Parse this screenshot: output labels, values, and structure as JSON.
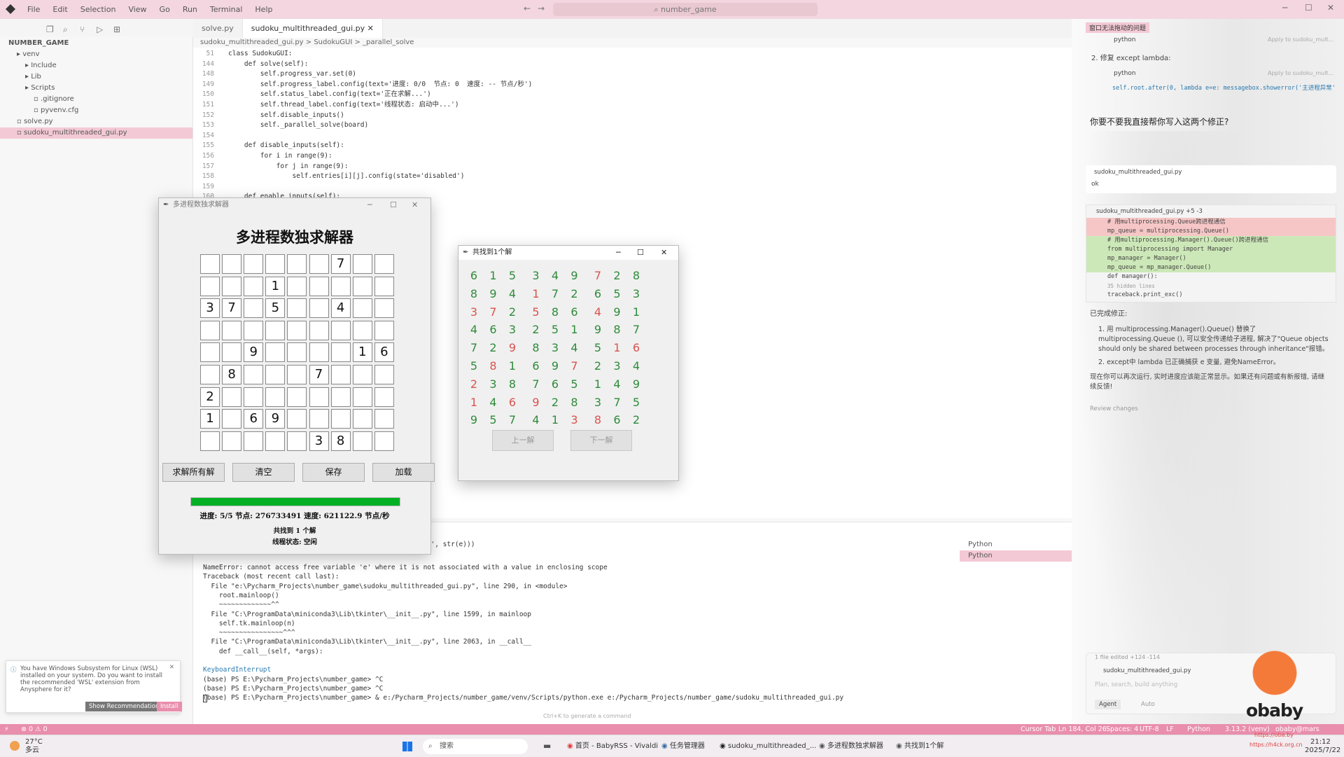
{
  "menu": [
    "File",
    "Edit",
    "Selection",
    "View",
    "Go",
    "Run",
    "Terminal",
    "Help"
  ],
  "search": "number_game",
  "explorer": {
    "root": "NUMBER_GAME",
    "items": [
      {
        "label": "venv",
        "indent": 1
      },
      {
        "label": "Include",
        "indent": 2
      },
      {
        "label": "Lib",
        "indent": 2
      },
      {
        "label": "Scripts",
        "indent": 2
      },
      {
        "label": ".gitignore",
        "indent": 3
      },
      {
        "label": "pyvenv.cfg",
        "indent": 3
      },
      {
        "label": "solve.py",
        "indent": 1
      },
      {
        "label": "sudoku_multithreaded_gui.py",
        "indent": 1,
        "selected": true
      }
    ]
  },
  "tabs": [
    {
      "label": "solve.py",
      "active": false
    },
    {
      "label": "sudoku_multithreaded_gui.py",
      "active": true
    }
  ],
  "breadcrumb": "sudoku_multithreaded_gui.py  >  SudokuGUI  >  _parallel_solve",
  "code": [
    {
      "n": "51",
      "t": "class SudokuGUI:"
    },
    {
      "n": "144",
      "t": "    def solve(self):"
    },
    {
      "n": "148",
      "t": "        self.progress_var.set(0)"
    },
    {
      "n": "149",
      "t": "        self.progress_label.config(text='进度: 0/0  节点: 0  速度: -- 节点/秒')"
    },
    {
      "n": "150",
      "t": "        self.status_label.config(text='正在求解...')"
    },
    {
      "n": "151",
      "t": "        self.thread_label.config(text='线程状态: 启动中...')"
    },
    {
      "n": "152",
      "t": "        self.disable_inputs()"
    },
    {
      "n": "153",
      "t": "        self._parallel_solve(board)"
    },
    {
      "n": "154",
      "t": ""
    },
    {
      "n": "155",
      "t": "    def disable_inputs(self):"
    },
    {
      "n": "156",
      "t": "        for i in range(9):"
    },
    {
      "n": "157",
      "t": "            for j in range(9):"
    },
    {
      "n": "158",
      "t": "                self.entries[i][j].config(state='disabled')"
    },
    {
      "n": "159",
      "t": ""
    },
    {
      "n": "160",
      "t": "    def enable_inputs(self):"
    }
  ],
  "terminal": [
    "NameError: cannot access free variable 'e' where it is not associated with a value in enclosing scope",
    "Traceback (most recent call last):",
    "  File \"e:\\Pycharm_Projects\\number_game\\sudoku_multithreaded_gui.py\", line 290, in <module>",
    "    root.mainloop()",
    "    ~~~~~~~~~~~~~^^",
    "  File \"C:\\ProgramData\\miniconda3\\Lib\\tkinter\\__init__.py\", line 1599, in mainloop",
    "    self.tk.mainloop(n)",
    "    ~~~~~~~~~~~~~~~~^^^",
    "  File \"C:\\ProgramData\\miniconda3\\Lib\\tkinter\\__init__.py\", line 2063, in __call__",
    "    def __call__(self, *args):",
    "",
    "KeyboardInterrupt",
    "(base) PS E:\\Pycharm_Projects\\number_game> ^C",
    "(base) PS E:\\Pycharm_Projects\\number_game> ^C",
    "(base) PS E:\\Pycharm_Projects\\number_game> & e:/Pycharm_Projects/number_game/venv/Scripts/python.exe e:/Pycharm_Projects/number_game/sudoku_multithreaded_gui.py"
  ],
  "terminal_top": "常', str(e)))",
  "terminal_hint": "Ctrl+K to generate a command",
  "panel_terms": [
    "Python",
    "Python"
  ],
  "solver": {
    "window_title": "多进程数独求解器",
    "title": "多进程数独求解器",
    "grid": [
      [
        "",
        "",
        "",
        "",
        "",
        "",
        "7",
        "",
        ""
      ],
      [
        "",
        "",
        "",
        "1",
        "",
        "",
        "",
        "",
        ""
      ],
      [
        "3",
        "7",
        "",
        "5",
        "",
        "",
        "4",
        "",
        ""
      ],
      [
        "",
        "",
        "",
        "",
        "",
        "",
        "",
        "",
        ""
      ],
      [
        "",
        "",
        "9",
        "",
        "",
        "",
        "",
        "1",
        "6"
      ],
      [
        "",
        "8",
        "",
        "",
        "",
        "7",
        "",
        "",
        ""
      ],
      [
        "2",
        "",
        "",
        "",
        "",
        "",
        "",
        "",
        ""
      ],
      [
        "1",
        "",
        "6",
        "9",
        "",
        "",
        "",
        "",
        ""
      ],
      [
        "",
        "",
        "",
        "",
        "",
        "3",
        "8",
        "",
        ""
      ]
    ],
    "buttons": [
      "求解所有解",
      "清空",
      "保存",
      "加载"
    ],
    "progress": 1.0,
    "progress_text": "进度: 5/5  节点: 276733491  速度: 621122.9 节点/秒",
    "status_text": "共找到 1 个解",
    "thread_text": "线程状态: 空闲"
  },
  "solutions": {
    "window_title": "共找到1个解",
    "grid": [
      [
        "6",
        "1",
        "5",
        "3",
        "4",
        "9",
        "7",
        "2",
        "8"
      ],
      [
        "8",
        "9",
        "4",
        "1",
        "7",
        "2",
        "6",
        "5",
        "3"
      ],
      [
        "3",
        "7",
        "2",
        "5",
        "8",
        "6",
        "4",
        "9",
        "1"
      ],
      [
        "4",
        "6",
        "3",
        "2",
        "5",
        "1",
        "9",
        "8",
        "7"
      ],
      [
        "7",
        "2",
        "9",
        "8",
        "3",
        "4",
        "5",
        "1",
        "6"
      ],
      [
        "5",
        "8",
        "1",
        "6",
        "9",
        "7",
        "2",
        "3",
        "4"
      ],
      [
        "2",
        "3",
        "8",
        "7",
        "6",
        "5",
        "1",
        "4",
        "9"
      ],
      [
        "1",
        "4",
        "6",
        "9",
        "2",
        "8",
        "3",
        "7",
        "5"
      ],
      [
        "9",
        "5",
        "7",
        "4",
        "1",
        "3",
        "8",
        "6",
        "2"
      ]
    ],
    "red": [
      [
        0,
        6
      ],
      [
        1,
        3
      ],
      [
        2,
        0
      ],
      [
        2,
        1
      ],
      [
        2,
        3
      ],
      [
        2,
        6
      ],
      [
        4,
        2
      ],
      [
        4,
        7
      ],
      [
        4,
        8
      ],
      [
        5,
        1
      ],
      [
        5,
        5
      ],
      [
        6,
        0
      ],
      [
        7,
        0
      ],
      [
        7,
        2
      ],
      [
        7,
        3
      ],
      [
        8,
        5
      ],
      [
        8,
        6
      ]
    ],
    "prev_label": "上一解",
    "next_label": "下一解"
  },
  "chat": {
    "header": "窗口无法拖动的问题",
    "lang1": "python",
    "apply": "Apply to sudoku_mult...",
    "fix2": "2. 修复 except lambda:",
    "lang2": "python",
    "code_line": "self.root.after(0, lambda e=e: messagebox.showerror('主进程异常'",
    "question": "你要不要我直接帮你写入这两个修正?",
    "file_chip": "sudoku_multithreaded_gui.py",
    "user_msg": "ok",
    "diff_file": "sudoku_multithreaded_gui.py +5 -3",
    "diff": [
      {
        "t": "# 用multiprocessing.Queue跨进程通信",
        "c": "del"
      },
      {
        "t": "mp_queue = multiprocessing.Queue()",
        "c": "del"
      },
      {
        "t": "# 用multiprocessing.Manager().Queue()跨进程通信",
        "c": "add"
      },
      {
        "t": "from multiprocessing import Manager",
        "c": "add"
      },
      {
        "t": "mp_manager = Manager()",
        "c": "add"
      },
      {
        "t": "mp_queue = mp_manager.Queue()",
        "c": "add"
      },
      {
        "t": "def manager():",
        "c": ""
      },
      {
        "t": "35 hidden lines",
        "c": "hint"
      },
      {
        "t": "    traceback.print_exc()",
        "c": ""
      }
    ],
    "done": "已完成修正:",
    "item1": "1. 用 multiprocessing.Manager().Queue() 替换了 multiprocessing.Queue (), 可以安全传递给子进程, 解决了\"Queue objects should only be shared between processes through inheritance\"报错。",
    "item2": "2. except中 lambda 已正确捕获 e 变量, 避免NameError。",
    "final": "现在你可以再次运行, 实时进度应该能正常显示。如果还有问题或有新报错, 请继续反馈!",
    "review": "Review changes",
    "files_edited": "1 file edited +124 -114",
    "input_file": "sudoku_multithreaded_gui.py",
    "input_placeholder": "Plan, search, build anything",
    "agent": "Agent",
    "auto": "Auto"
  },
  "notif": {
    "text": "You have Windows Subsystem for Linux (WSL) installed on your system. Do you want to install the recommended 'WSL' extension from Anysphere for it?",
    "btn1": "Show Recommendations",
    "btn2": "Install"
  },
  "statusbar": {
    "left": "⊗ 0 ⚠ 0",
    "cursor_tab": "Cursor Tab",
    "pos": "Ln 184, Col 26",
    "spaces": "Spaces: 4",
    "enc": "UTF-8",
    "eol": "LF",
    "lang": "Python",
    "ver": "3.13.2 (venv)",
    "extra": "obaby@mars"
  },
  "taskbar": {
    "weather": "27°C",
    "weather2": "多云",
    "search": "搜索",
    "items": [
      "首页 - BabyRSS - Vivaldi",
      "任务管理器",
      "sudoku_multithreaded_...",
      "多进程数独求解器",
      "共找到1个解"
    ],
    "time": "21:12",
    "date": "2025/7/22"
  },
  "watermark": {
    "brand": "obaby",
    "url1": "https://oba.by",
    "url2": "https://h4ck.org.cn"
  },
  "colors": {
    "accent": "#e98eac",
    "title": "#f3d6df",
    "progress": "#06b025",
    "green": "#2e8b3a",
    "red": "#d9534f"
  }
}
